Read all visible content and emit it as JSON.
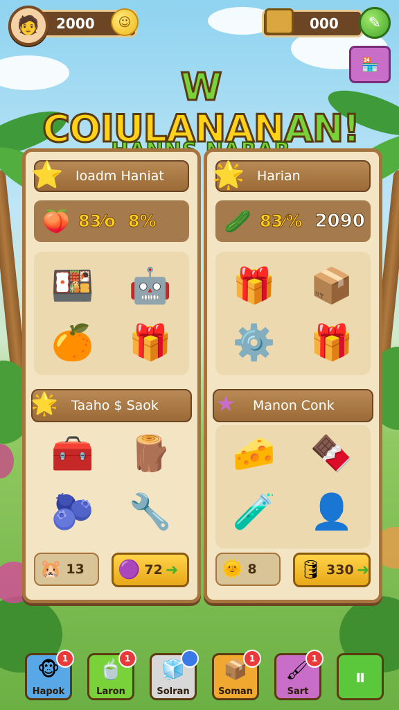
{
  "top": {
    "coins": "2000",
    "gems": "000"
  },
  "title": {
    "main_a": "W",
    "main_b": "COIULANAN",
    "main_c": "AN!",
    "subtitle": "HANNS NARAR"
  },
  "shop_button": {
    "icon": "store-icon"
  },
  "left_panel": {
    "header": "Ioadm Haniat",
    "stat_a": "83⁄o",
    "stat_b": "8%",
    "items_top": [
      "🍱",
      "🤖",
      "🍊",
      "🎁"
    ],
    "sub_header": "Taaho $ Saok",
    "items_bottom": [
      "🧰",
      "🪵",
      "🫐",
      "🔧"
    ],
    "foot_left": "13",
    "foot_right": "72"
  },
  "right_panel": {
    "header": "Harian",
    "stat_a": "83⁄%",
    "stat_b": "2090",
    "items_top": [
      "🎁",
      "📦",
      "⚙️",
      "🎁"
    ],
    "sub_header": "Manon Conk",
    "items_bottom": [
      "🧀",
      "🍫",
      "🧪",
      "👤"
    ],
    "foot_left": "8",
    "foot_right": "330"
  },
  "nav": [
    {
      "label": "Hapok",
      "icon": "🐵",
      "badge": "1",
      "color": "#58a8e8"
    },
    {
      "label": "Laron",
      "icon": "🍵",
      "badge": "1",
      "color": "#7ad23a"
    },
    {
      "label": "Solran",
      "icon": "🧊",
      "badge": "",
      "color": "#d8d8d8"
    },
    {
      "label": "Soman",
      "icon": "📦",
      "badge": "1",
      "color": "#f0a830"
    },
    {
      "label": "Sart",
      "icon": "🖌",
      "badge": "1",
      "color": "#c86ec8"
    },
    {
      "label": "",
      "icon": "⏸",
      "badge": "",
      "color": "#5ac83a"
    }
  ],
  "colors": {
    "accent": "#ffd21a",
    "wood": "#a8743d",
    "panel": "#f3e4c4"
  }
}
